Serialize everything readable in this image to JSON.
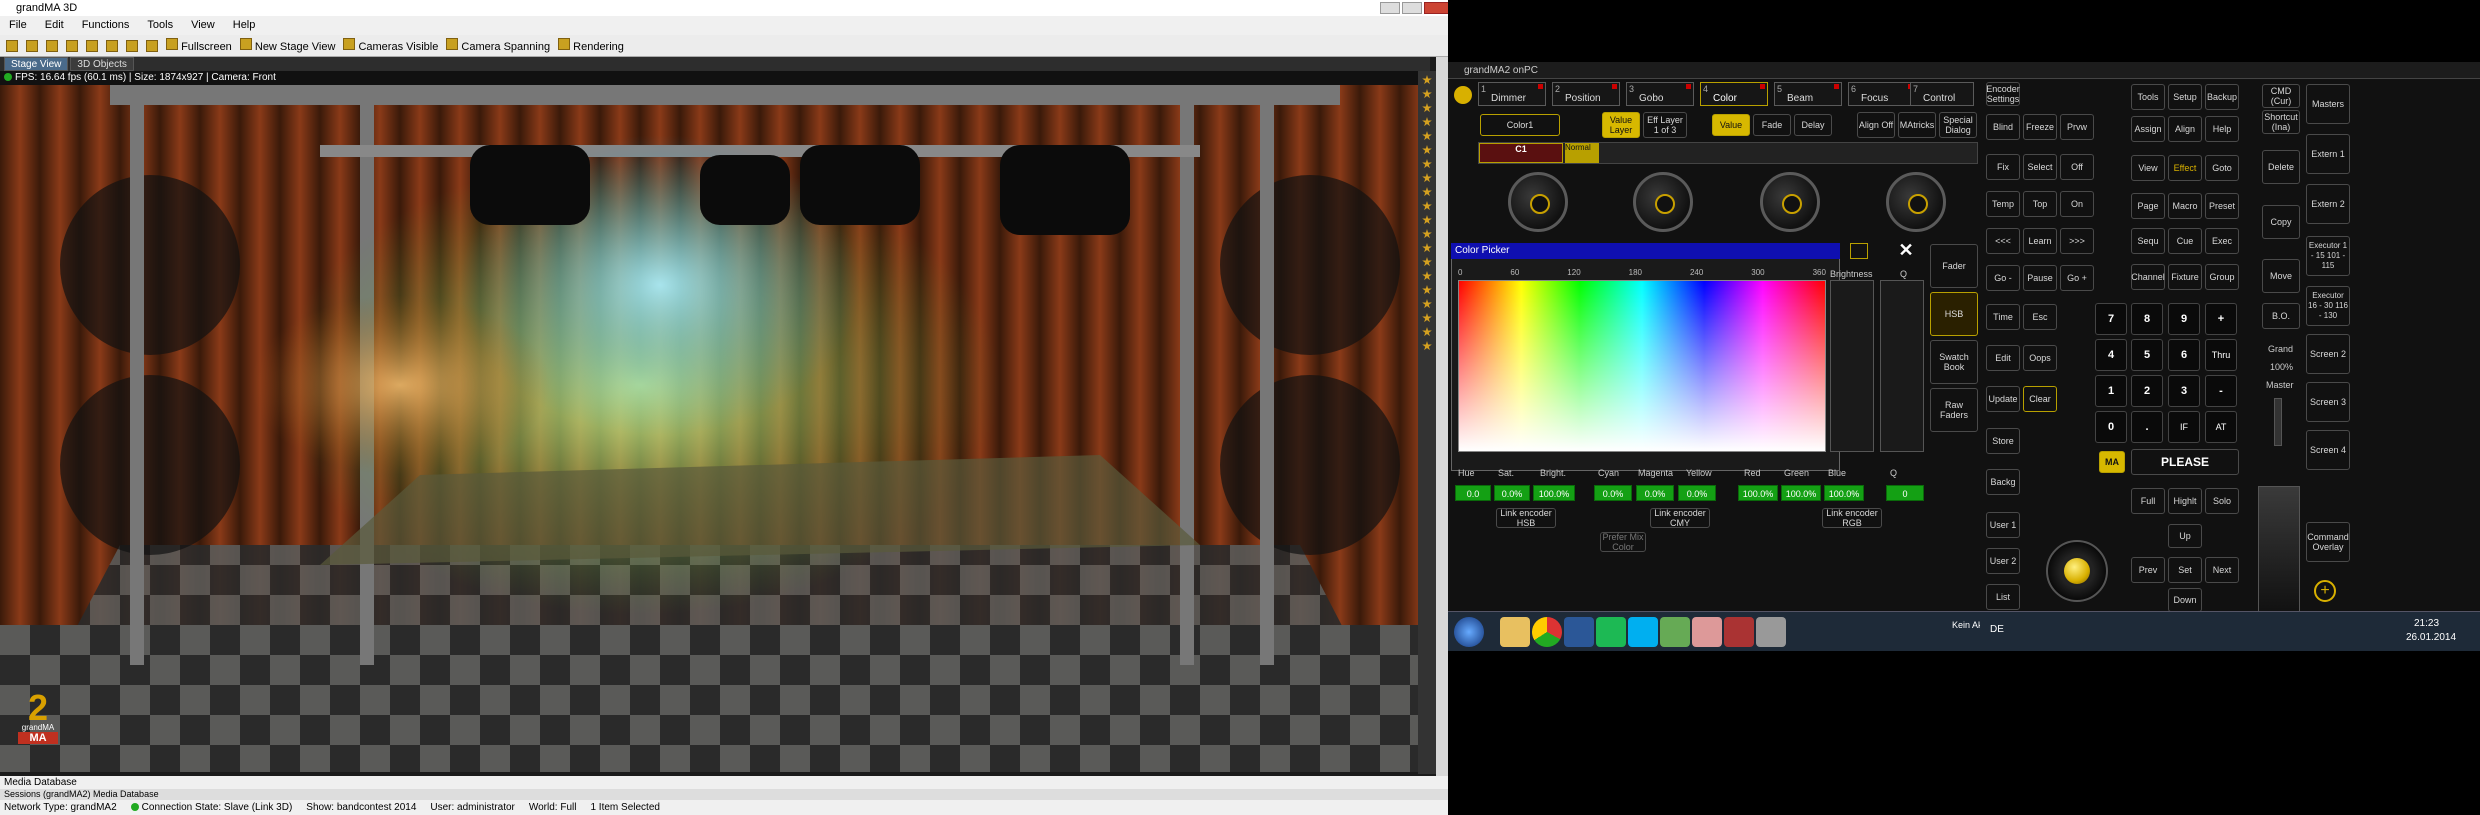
{
  "left_window": {
    "title": "grandMA 3D",
    "menu": [
      "File",
      "Edit",
      "Functions",
      "Tools",
      "View",
      "Help"
    ],
    "toolbar": [
      "Fullscreen",
      "New Stage View",
      "Cameras Visible",
      "Camera Spanning",
      "Rendering"
    ],
    "tabs": [
      "Stage View",
      "3D Objects"
    ],
    "status_line": "FPS: 16.64 fps (60.1 ms) | Size: 1874x927 | Camera: Front",
    "logo_text": "grandMA",
    "logo_mark": "MA",
    "media_database": "Media Database",
    "media_tabs": "Sessions (grandMA2)   Media Database",
    "bottom": {
      "network": "Network Type: grandMA2",
      "connection": "Connection State: Slave (Link 3D)",
      "show": "Show: bandcontest 2014",
      "user": "User: administrator",
      "world": "World: Full",
      "selected": "1 Item Selected"
    }
  },
  "right_window": {
    "title": "grandMA2 onPC",
    "preset_tabs": [
      {
        "num": "1",
        "label": "Dimmer"
      },
      {
        "num": "2",
        "label": "Position"
      },
      {
        "num": "3",
        "label": "Gobo"
      },
      {
        "num": "4",
        "label": "Color"
      },
      {
        "num": "5",
        "label": "Beam"
      },
      {
        "num": "6",
        "label": "Focus"
      },
      {
        "num": "7",
        "label": "Control"
      }
    ],
    "row2": [
      "Color1",
      "Value Layer",
      "Eff Layer 1 of 3",
      "Value",
      "Fade",
      "Delay",
      "Align Off",
      "MAtricks",
      "Special Dialog"
    ],
    "encoder_bar": {
      "channel": "C1",
      "label": "Normal"
    },
    "color_picker": {
      "title": "Color Picker",
      "scale": [
        "0",
        "60",
        "120",
        "180",
        "240",
        "300",
        "360"
      ],
      "brightness": "Brightness",
      "q": "Q",
      "side_buttons": [
        "Fader",
        "HSB",
        "Swatch Book",
        "Raw Faders"
      ],
      "params": [
        {
          "label": "Hue",
          "value": "0.0"
        },
        {
          "label": "Sat.",
          "value": "0.0%"
        },
        {
          "label": "Bright.",
          "value": "100.0%"
        },
        {
          "label": "Cyan",
          "value": "0.0%"
        },
        {
          "label": "Magenta",
          "value": "0.0%"
        },
        {
          "label": "Yellow",
          "value": "0.0%"
        },
        {
          "label": "Red",
          "value": "100.0%"
        },
        {
          "label": "Green",
          "value": "100.0%"
        },
        {
          "label": "Blue",
          "value": "100.0%"
        },
        {
          "label": "Q",
          "value": "0"
        }
      ],
      "links": [
        "Link encoder HSB",
        "Link encoder CMY",
        "Link encoder RGB",
        "Prefer Mix Color"
      ]
    },
    "col1": [
      "Encoder Settings",
      "Blind",
      "Freeze",
      "Prvw",
      "Fix",
      "Select",
      "Off",
      "Temp",
      "Top",
      "On",
      "<<<",
      "Learn",
      ">>>",
      "Go -",
      "Pause",
      "Go +",
      "Time",
      "Esc",
      "Edit",
      "Oops",
      "Update",
      "Clear",
      "Store",
      "Backg",
      "User 1",
      "User 2",
      "List"
    ],
    "col2": [
      "Tools",
      "Setup",
      "Backup",
      "Assign",
      "Align",
      "Help",
      "View",
      "Effect",
      "Goto",
      "Page",
      "Macro",
      "Preset",
      "Sequ",
      "Cue",
      "Exec",
      "Channel",
      "Fixture",
      "Group"
    ],
    "keypad": [
      "7",
      "8",
      "9",
      "+",
      "4",
      "5",
      "6",
      "Thru",
      "1",
      "2",
      "3",
      "-",
      "0",
      ".",
      "IF",
      "AT"
    ],
    "please": "PLEASE",
    "ma_key": "MA",
    "nav": [
      "Full",
      "Highlt",
      "Solo",
      "Up",
      "Prev",
      "Set",
      "Next",
      "Down"
    ],
    "col3": [
      "CMD (Cur)",
      "Shortcut (Ina)",
      "Delete",
      "Copy",
      "Move",
      "B.O.",
      "Grand",
      "Master"
    ],
    "grand_value": "100%",
    "col4": [
      "Masters",
      "Extern 1",
      "Extern 2",
      "Executor 1 - 15 101 - 115",
      "Executor 16 - 30 116 - 130",
      "Screen 2",
      "Screen 3",
      "Screen 4",
      "Command Overlay"
    ]
  },
  "taskbar": {
    "lang": "DE",
    "time": "21:23",
    "date": "26.01.2014",
    "keep": "Kein Akku"
  }
}
